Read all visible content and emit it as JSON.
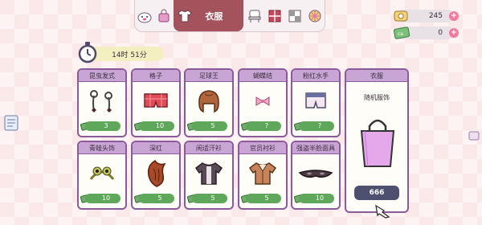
{
  "tabs": [
    {
      "icon": "pet-icon",
      "label": ""
    },
    {
      "icon": "bag-icon",
      "label": ""
    },
    {
      "icon": "shirt-icon",
      "label": "衣服",
      "active": true
    },
    {
      "icon": "chair-icon",
      "label": ""
    },
    {
      "icon": "window-icon",
      "label": ""
    },
    {
      "icon": "tile-icon",
      "label": ""
    },
    {
      "icon": "ball-icon",
      "label": ""
    }
  ],
  "currency": {
    "coins": "245",
    "tickets": "0"
  },
  "timer": "14时 51分",
  "items": [
    {
      "name": "昆虫发式",
      "price": "3",
      "art": "antenna-hairpin"
    },
    {
      "name": "格子",
      "price": "10",
      "art": "plaid-shorts"
    },
    {
      "name": "足球王",
      "price": "5",
      "art": "hair-wig"
    },
    {
      "name": "蝴蝶结",
      "price": "?",
      "art": "bow"
    },
    {
      "name": "粉红水手",
      "price": "?",
      "art": "sailor-shorts"
    },
    {
      "name": "青蛙头饰",
      "price": "10",
      "art": "frog-headband"
    },
    {
      "name": "深红",
      "price": "5",
      "art": "red-hair"
    },
    {
      "name": "闲适汗衫",
      "price": "5",
      "art": "casual-shirt"
    },
    {
      "name": "官员衬衫",
      "price": "5",
      "art": "official-shirt"
    },
    {
      "name": "强盗半脸面具",
      "price": "10",
      "art": "bandit-mask"
    }
  ],
  "random": {
    "title": "衣服",
    "subtitle": "随机服饰",
    "price": "666"
  }
}
